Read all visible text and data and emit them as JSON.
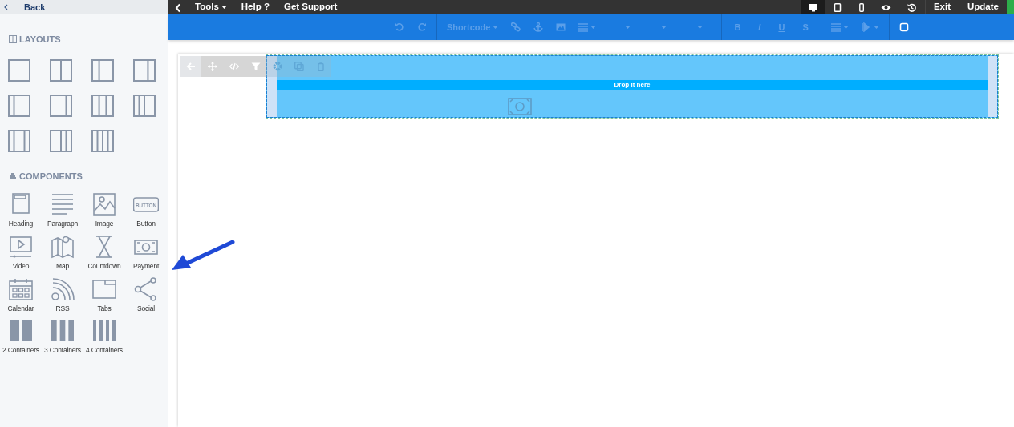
{
  "sidebar": {
    "back": "Back",
    "layouts_heading": "LAYOUTS",
    "components_heading": "COMPONENTS",
    "components": [
      {
        "label": "Heading"
      },
      {
        "label": "Paragraph"
      },
      {
        "label": "Image"
      },
      {
        "label": "Button",
        "icon_text": "BUTTON"
      },
      {
        "label": "Video"
      },
      {
        "label": "Map"
      },
      {
        "label": "Countdown"
      },
      {
        "label": "Payment"
      },
      {
        "label": "Calendar"
      },
      {
        "label": "RSS"
      },
      {
        "label": "Tabs"
      },
      {
        "label": "Social"
      },
      {
        "label": "2 Containers"
      },
      {
        "label": "3 Containers"
      },
      {
        "label": "4 Containers"
      }
    ]
  },
  "top_menu": {
    "items": [
      {
        "label": "Tools",
        "dropdown": true
      },
      {
        "label": "Help ?",
        "dropdown": false
      },
      {
        "label": "Get Support",
        "dropdown": false
      }
    ],
    "devices": [
      {
        "selected": true
      },
      {
        "selected": false
      },
      {
        "selected": false
      }
    ],
    "buttons": [
      "Exit",
      "Update"
    ]
  },
  "format_toolbar": [
    [
      {
        "kind": "icon",
        "disabled": true
      },
      {
        "kind": "icon",
        "disabled": true
      }
    ],
    [
      {
        "kind": "dropdown",
        "text": "Shortcode",
        "disabled": true
      },
      {
        "kind": "icon",
        "disabled": true
      },
      {
        "kind": "icon",
        "disabled": true
      },
      {
        "kind": "icon",
        "disabled": true
      },
      {
        "kind": "icon-dropdown",
        "disabled": true
      }
    ],
    [
      {
        "kind": "dropdown",
        "disabled": true
      },
      {
        "kind": "dropdown",
        "disabled": true
      },
      {
        "kind": "dropdown",
        "disabled": true
      }
    ],
    [
      {
        "kind": "text",
        "text": "B",
        "disabled": true
      },
      {
        "kind": "text",
        "text": "I",
        "disabled": true
      },
      {
        "kind": "text",
        "text": "U",
        "disabled": true
      },
      {
        "kind": "text",
        "text": "S",
        "disabled": true
      }
    ],
    [
      {
        "kind": "icon-dropdown",
        "disabled": true
      },
      {
        "kind": "icon-dropdown",
        "disabled": true
      }
    ],
    [
      {
        "kind": "icon",
        "disabled": false
      }
    ]
  ],
  "canvas": {
    "drop_hint": "Drop it here"
  }
}
